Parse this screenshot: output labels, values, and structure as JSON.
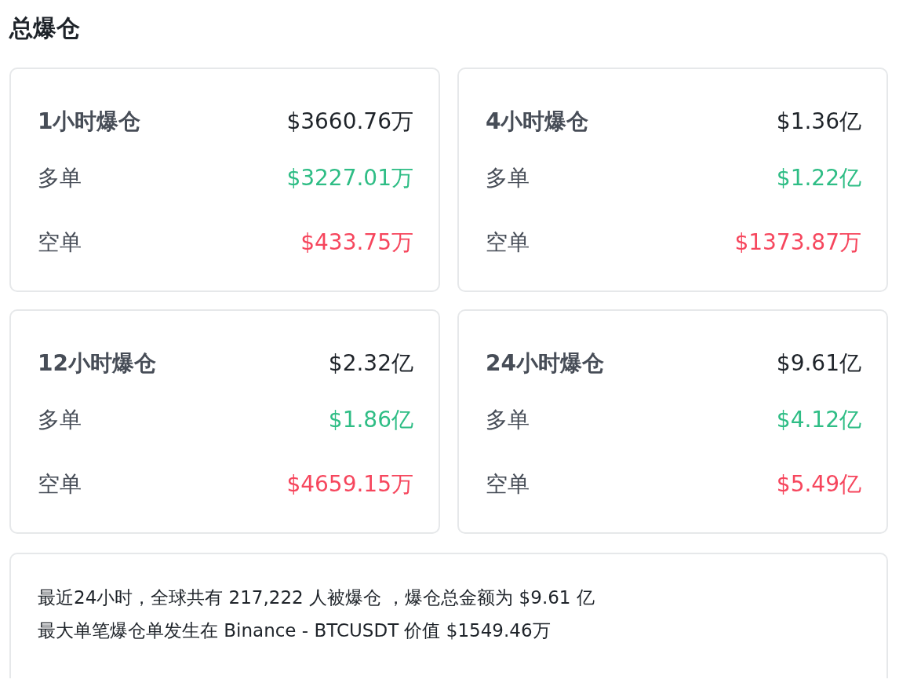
{
  "title": "总爆仓",
  "cards": [
    {
      "rows": [
        {
          "kind": "total",
          "label": "1小时爆仓",
          "value": "$3660.76万"
        },
        {
          "kind": "long",
          "label": "多单",
          "value": "$3227.01万"
        },
        {
          "kind": "short",
          "label": "空单",
          "value": "$433.75万"
        }
      ]
    },
    {
      "rows": [
        {
          "kind": "total",
          "label": "4小时爆仓",
          "value": "$1.36亿"
        },
        {
          "kind": "long",
          "label": "多单",
          "value": "$1.22亿"
        },
        {
          "kind": "short",
          "label": "空单",
          "value": "$1373.87万"
        }
      ]
    },
    {
      "rows": [
        {
          "kind": "total",
          "label": "12小时爆仓",
          "value": "$2.32亿"
        },
        {
          "kind": "long",
          "label": "多单",
          "value": "$1.86亿"
        },
        {
          "kind": "short",
          "label": "空单",
          "value": "$4659.15万"
        }
      ]
    },
    {
      "rows": [
        {
          "kind": "total",
          "label": "24小时爆仓",
          "value": "$9.61亿"
        },
        {
          "kind": "long",
          "label": "多单",
          "value": "$4.12亿"
        },
        {
          "kind": "short",
          "label": "空单",
          "value": "$5.49亿"
        }
      ]
    }
  ],
  "summary": [
    "最近24小时，全球共有 217,222 人被爆仓 ，爆仓总金额为 $9.61 亿",
    "最大单笔爆仓单发生在 Binance - BTCUSDT 价值 $1549.46万"
  ]
}
